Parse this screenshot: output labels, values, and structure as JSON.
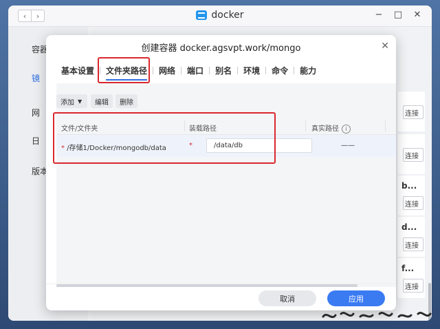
{
  "app": {
    "title": "docker",
    "icon": "docker-logo-icon",
    "back": "‹",
    "forward": "›",
    "minimize": "−",
    "maximize": "□",
    "close": "✕"
  },
  "sidebar": {
    "items": [
      "容器",
      "镜",
      "网",
      "日",
      "版本"
    ]
  },
  "background": {
    "cards": [
      {
        "text": "",
        "button": "连接"
      },
      {
        "text": "",
        "button": "连接"
      },
      {
        "text": "b...",
        "button": "连接"
      },
      {
        "text": "d...",
        "button": "连接"
      },
      {
        "text": "f...",
        "button": "连接"
      }
    ]
  },
  "dialog": {
    "title": "创建容器 docker.agsvpt.work/mongo",
    "close": "✕",
    "tabs": [
      "基本设置",
      "文件夹路径",
      "网络",
      "端口",
      "别名",
      "环境",
      "命令",
      "能力"
    ],
    "active_tab": "文件夹路径",
    "toolbar": {
      "add": "添加",
      "edit": "编辑",
      "delete": "删除",
      "caret": "▼"
    },
    "table": {
      "headers": [
        "文件/文件夹",
        "装载路径",
        "真实路径"
      ],
      "info_icon": "i",
      "rows": [
        {
          "required": "*",
          "file": "/存储1/Docker/mongodb/data",
          "mount_path": "/data/db",
          "real_path": "——"
        }
      ]
    },
    "footer": {
      "cancel": "取消",
      "apply": "应用"
    }
  },
  "colors": {
    "accent": "#3a7bf2",
    "highlight": "#d9272e"
  }
}
